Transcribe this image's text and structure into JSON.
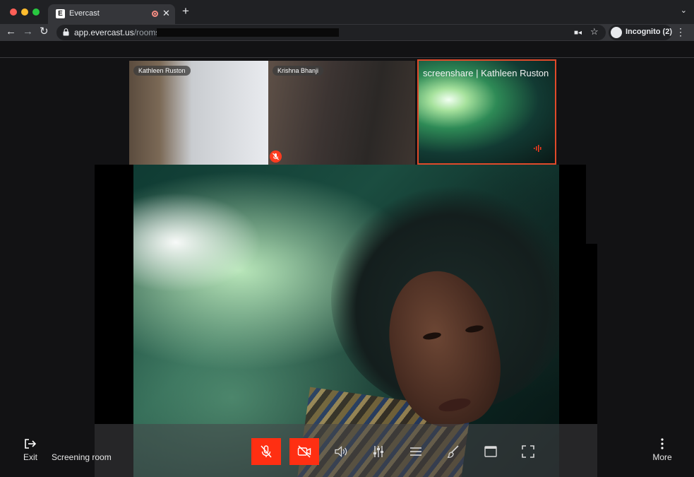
{
  "browser": {
    "tab": {
      "title": "Evercast",
      "favicon_letter": "E"
    },
    "url": {
      "host": "app.evercast.us",
      "path": "/rooms/"
    },
    "incognito_label": "Incognito (2)",
    "tab_close": "✕",
    "new_tab": "+",
    "tabs_menu": "⌄"
  },
  "participants": [
    {
      "name": "Kathleen Ruston",
      "muted": false
    },
    {
      "name": "Krishna Bhanji",
      "muted": true
    },
    {
      "name": "screenshare | Kathleen Ruston",
      "speaking": true,
      "highlight_color": "#e04a2a"
    }
  ],
  "controls": {
    "exit_label": "Exit",
    "room_name": "Screening room",
    "more_label": "More",
    "mic_state": "muted",
    "camera_state": "off",
    "accent_color": "#ff2f12"
  },
  "icons": [
    "lock-icon",
    "camera-icon",
    "star-icon",
    "incognito-icon",
    "mic-off-icon",
    "camera-off-icon",
    "speaker-icon",
    "sliders-icon",
    "menu-icon",
    "brush-icon",
    "window-icon",
    "fullscreen-icon",
    "exit-icon",
    "more-vert-icon"
  ]
}
